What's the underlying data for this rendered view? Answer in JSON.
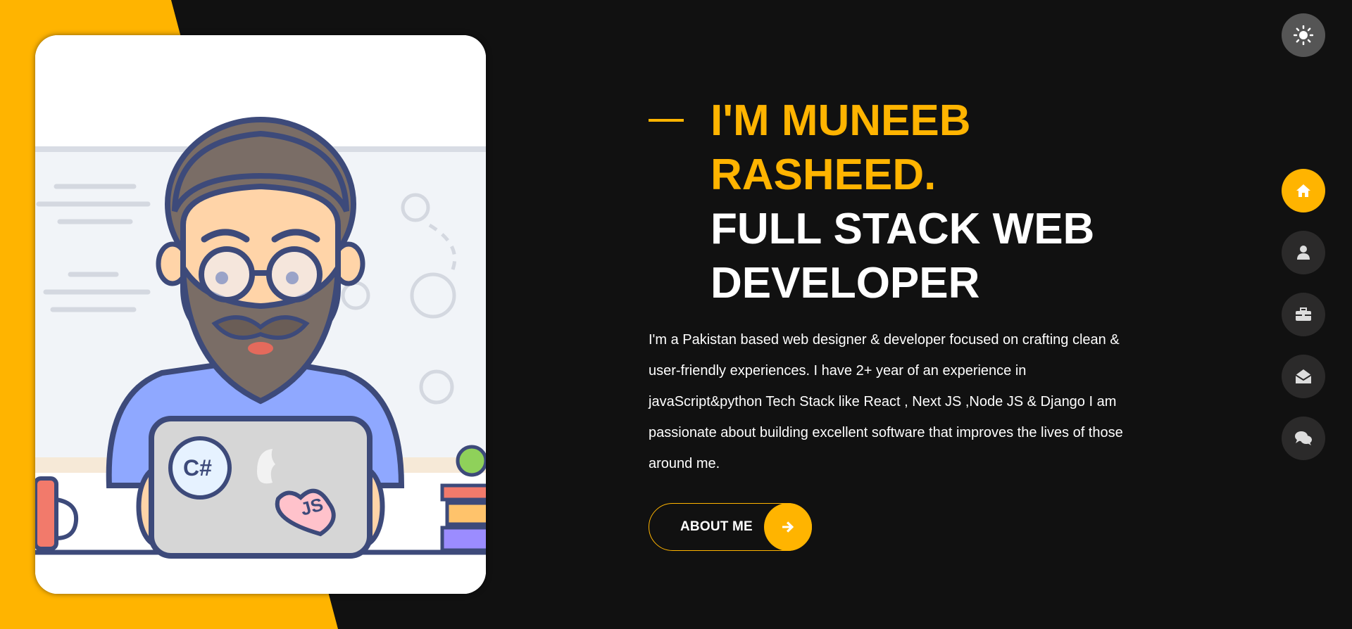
{
  "theme": {
    "accent": "#ffb400",
    "background": "#111111",
    "nav_inactive": "#2b2a2a"
  },
  "hero": {
    "name_line": "I'M MUNEEB RASHEED.",
    "role_line": "FULL STACK WEB DEVELOPER",
    "intro": "I'm a Pakistan based web designer & developer focused on crafting clean & user-friendly experiences. I have 2+ year of an experience in javaScript&python Tech Stack like React , Next JS ,Node JS & Django I am passionate about building excellent software that improves the lives of those around me.",
    "cta_label": "ABOUT ME",
    "cta_icon": "arrow-right-icon"
  },
  "photo": {
    "icon": "developer-illustration",
    "badges": [
      "C#",
      "JS"
    ]
  },
  "theme_toggle": {
    "icon": "sun-icon"
  },
  "nav": {
    "active": "home",
    "items": [
      {
        "id": "home",
        "icon": "home-icon"
      },
      {
        "id": "about",
        "icon": "user-icon"
      },
      {
        "id": "portfolio",
        "icon": "briefcase-icon"
      },
      {
        "id": "contact",
        "icon": "envelope-open-icon"
      },
      {
        "id": "blog",
        "icon": "comments-icon"
      }
    ]
  }
}
